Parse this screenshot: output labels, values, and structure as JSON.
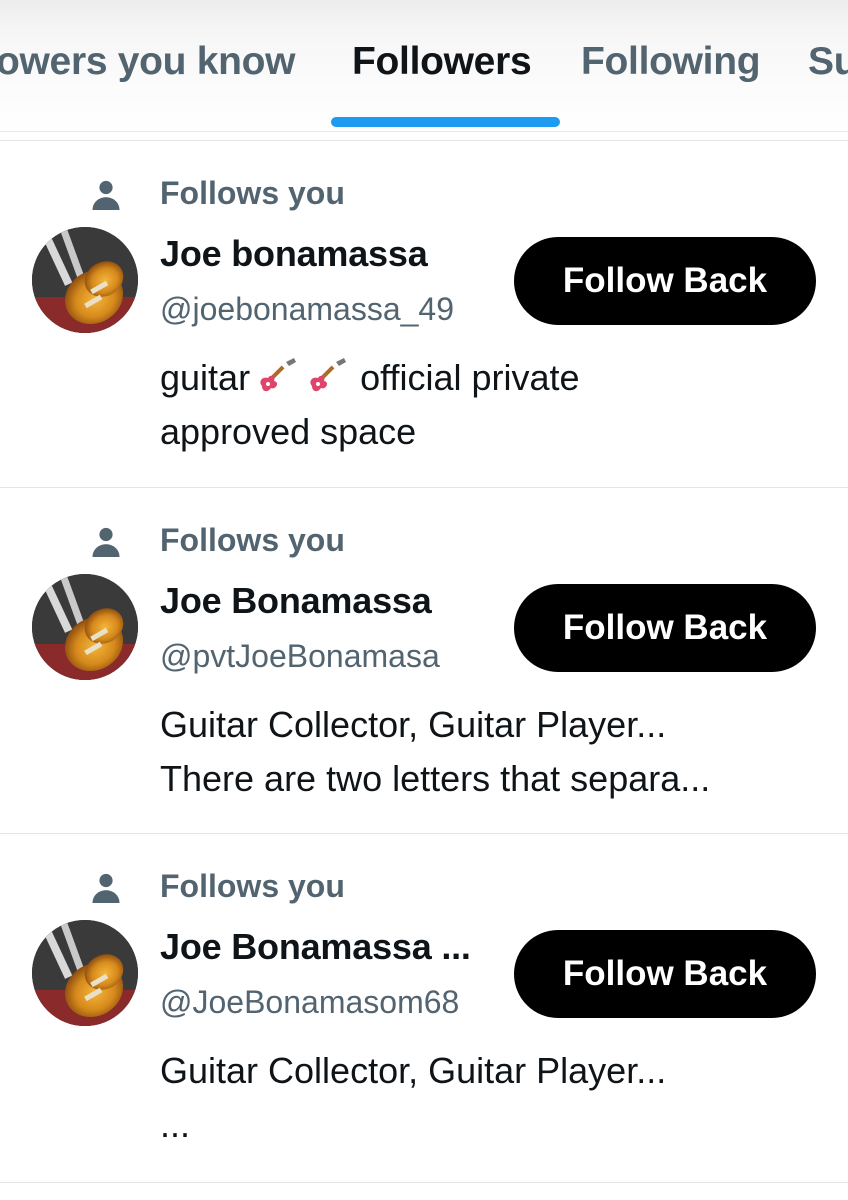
{
  "tabs": [
    {
      "label": "owers you know",
      "active": false
    },
    {
      "label": "Followers",
      "active": true
    },
    {
      "label": "Following",
      "active": false
    },
    {
      "label": "Su",
      "active": false
    }
  ],
  "accent_color": "#1d9bf0",
  "followers": [
    {
      "follows_label": "Follows you",
      "display_name": "Joe bonamassa",
      "handle": "@joebonamassa_49",
      "button_label": "Follow Back",
      "bio_part1": "guitar",
      "bio_emoji": "guitar-emoji",
      "bio_part2": "official private",
      "bio_line2": "approved space"
    },
    {
      "follows_label": "Follows you",
      "display_name": "Joe Bonamassa",
      "handle": "@pvtJoeBonamasa",
      "button_label": "Follow Back",
      "bio_line1": "Guitar Collector, Guitar Player...",
      "bio_line2": "There are two letters that separa..."
    },
    {
      "follows_label": "Follows you",
      "display_name": "Joe Bonamassa ...",
      "handle": "@JoeBonamasom68",
      "button_label": "Follow Back",
      "bio_line1": "Guitar Collector, Guitar Player...",
      "bio_line2": "..."
    }
  ]
}
